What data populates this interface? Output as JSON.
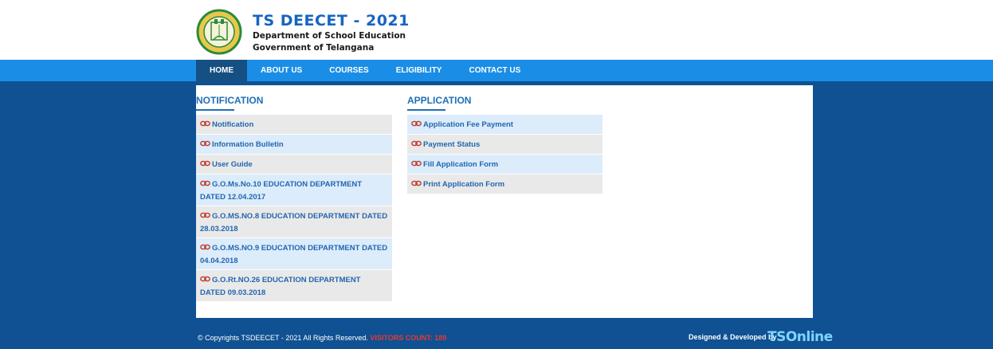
{
  "header": {
    "title": "TS DEECET - 2021",
    "subtitle1": "Department of School Education",
    "subtitle2": "Government of Telangana",
    "logo_icon": "telangana-emblem-icon"
  },
  "nav": {
    "items": [
      {
        "label": "HOME",
        "active": true
      },
      {
        "label": "ABOUT US",
        "active": false
      },
      {
        "label": "COURSES",
        "active": false
      },
      {
        "label": "ELIGIBILITY",
        "active": false
      },
      {
        "label": "CONTACT US",
        "active": false
      }
    ]
  },
  "notification": {
    "heading": "NOTIFICATION",
    "items": [
      "Notification",
      "Information Bulletin",
      "User Guide",
      "G.O.Ms.No.10 EDUCATION DEPARTMENT DATED 12.04.2017",
      "G.O.MS.NO.8 EDUCATION DEPARTMENT DATED 28.03.2018",
      "G.O.MS.NO.9 EDUCATION DEPARTMENT DATED 04.04.2018",
      "G.O.Rt.NO.26 EDUCATION DEPARTMENT DATED 09.03.2018"
    ]
  },
  "application": {
    "heading": "APPLICATION",
    "items": [
      "Application Fee Payment",
      "Payment Status",
      "Fill Application Form",
      "Print Application Form"
    ]
  },
  "footer": {
    "copyright": "© Copyrights TSDEECET - 2021 All Rights Reserved.",
    "visitors": "VISITORS COUNT: 189",
    "designed": "Designed & Developed by",
    "brand": "TSOnline"
  },
  "colors": {
    "nav_bg": "#1a8ee6",
    "band_bg": "#0f5192",
    "link": "#2366b0",
    "visitors": "#e53935"
  }
}
